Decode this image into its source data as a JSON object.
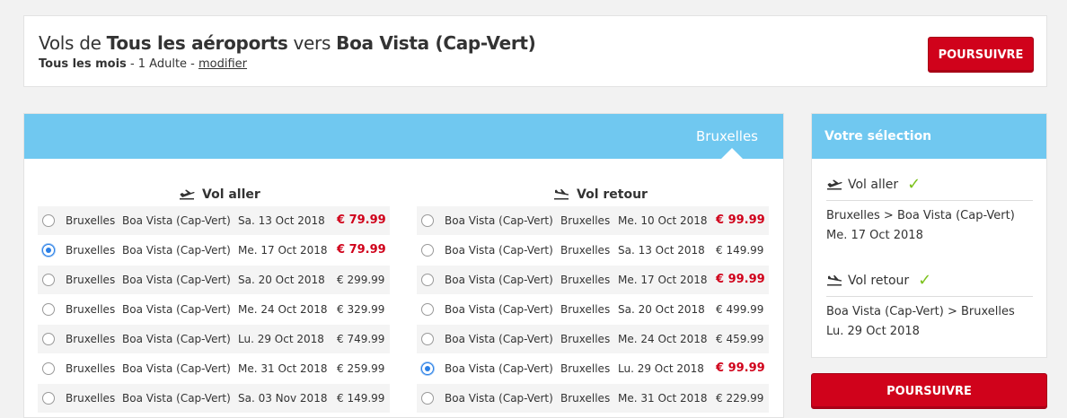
{
  "search": {
    "title_prefix": "Vols de ",
    "title_from": "Tous les aéroports",
    "title_mid": " vers ",
    "title_to": "Boa Vista (Cap-Vert)",
    "period": "Tous les mois",
    "passengers": " - 1 Adulte - ",
    "modify_label": "modifier",
    "continue_label": "POURSUIVRE"
  },
  "main": {
    "tab_city": "Bruxelles",
    "outbound": {
      "title": "Vol aller",
      "rows": [
        {
          "from": "Bruxelles",
          "to": "Boa Vista (Cap-Vert)",
          "date": "Sa. 13 Oct 2018",
          "price": "€ 79.99",
          "highlight": true,
          "selected": false
        },
        {
          "from": "Bruxelles",
          "to": "Boa Vista (Cap-Vert)",
          "date": "Me. 17 Oct 2018",
          "price": "€ 79.99",
          "highlight": true,
          "selected": true
        },
        {
          "from": "Bruxelles",
          "to": "Boa Vista (Cap-Vert)",
          "date": "Sa. 20 Oct 2018",
          "price": "€ 299.99",
          "highlight": false,
          "selected": false
        },
        {
          "from": "Bruxelles",
          "to": "Boa Vista (Cap-Vert)",
          "date": "Me. 24 Oct 2018",
          "price": "€ 329.99",
          "highlight": false,
          "selected": false
        },
        {
          "from": "Bruxelles",
          "to": "Boa Vista (Cap-Vert)",
          "date": "Lu. 29 Oct 2018",
          "price": "€ 749.99",
          "highlight": false,
          "selected": false
        },
        {
          "from": "Bruxelles",
          "to": "Boa Vista (Cap-Vert)",
          "date": "Me. 31 Oct 2018",
          "price": "€ 259.99",
          "highlight": false,
          "selected": false
        },
        {
          "from": "Bruxelles",
          "to": "Boa Vista (Cap-Vert)",
          "date": "Sa. 03 Nov 2018",
          "price": "€ 149.99",
          "highlight": false,
          "selected": false
        }
      ]
    },
    "inbound": {
      "title": "Vol retour",
      "rows": [
        {
          "from": "Boa Vista (Cap-Vert)",
          "to": "Bruxelles",
          "date": "Me. 10 Oct 2018",
          "price": "€ 99.99",
          "highlight": true,
          "selected": false
        },
        {
          "from": "Boa Vista (Cap-Vert)",
          "to": "Bruxelles",
          "date": "Sa. 13 Oct 2018",
          "price": "€ 149.99",
          "highlight": false,
          "selected": false
        },
        {
          "from": "Boa Vista (Cap-Vert)",
          "to": "Bruxelles",
          "date": "Me. 17 Oct 2018",
          "price": "€ 99.99",
          "highlight": true,
          "selected": false
        },
        {
          "from": "Boa Vista (Cap-Vert)",
          "to": "Bruxelles",
          "date": "Sa. 20 Oct 2018",
          "price": "€ 499.99",
          "highlight": false,
          "selected": false
        },
        {
          "from": "Boa Vista (Cap-Vert)",
          "to": "Bruxelles",
          "date": "Me. 24 Oct 2018",
          "price": "€ 459.99",
          "highlight": false,
          "selected": false
        },
        {
          "from": "Boa Vista (Cap-Vert)",
          "to": "Bruxelles",
          "date": "Lu. 29 Oct 2018",
          "price": "€ 99.99",
          "highlight": true,
          "selected": true
        },
        {
          "from": "Boa Vista (Cap-Vert)",
          "to": "Bruxelles",
          "date": "Me. 31 Oct 2018",
          "price": "€ 229.99",
          "highlight": false,
          "selected": false
        }
      ]
    }
  },
  "selection": {
    "title": "Votre sélection",
    "outbound_title": "Vol aller",
    "outbound_route": "Bruxelles > Boa Vista (Cap-Vert)",
    "outbound_date": "Me. 17 Oct 2018",
    "inbound_title": "Vol retour",
    "inbound_route": "Boa Vista (Cap-Vert) > Bruxelles",
    "inbound_date": "Lu. 29 Oct 2018",
    "continue_label": "POURSUIVRE",
    "check_icon": "check-icon"
  },
  "colors": {
    "accent_blue": "#70c8f0",
    "cta_red": "#d0021b",
    "check_green": "#7cc21c"
  }
}
